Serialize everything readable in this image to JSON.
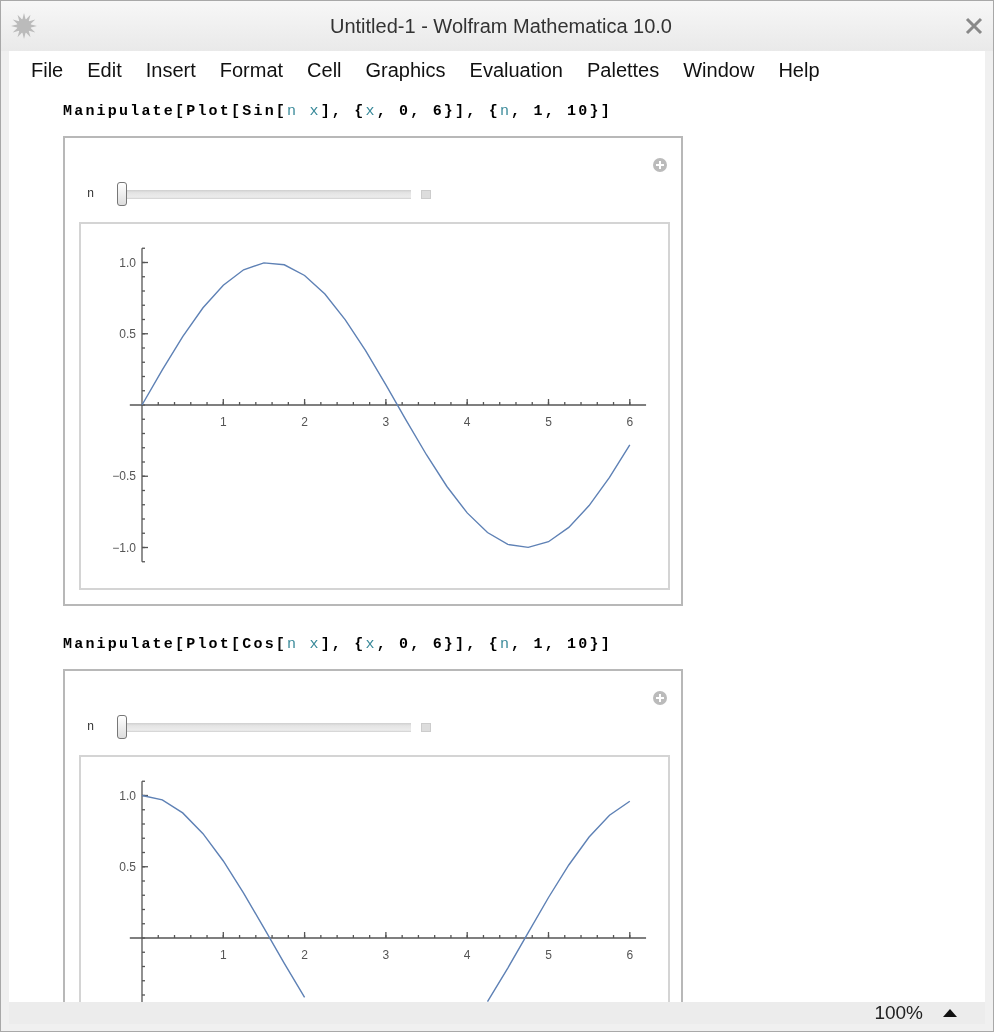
{
  "window": {
    "title": "Untitled-1 - Wolfram Mathematica 10.0"
  },
  "menu": [
    "File",
    "Edit",
    "Insert",
    "Format",
    "Cell",
    "Graphics",
    "Evaluation",
    "Palettes",
    "Window",
    "Help"
  ],
  "cells": [
    {
      "code": "**Manipulate[Plot[Sin[**n x**], {**x**, 0, 6}], {**n**, 1, 10}]**",
      "control": {
        "label": "n",
        "level": 0
      },
      "chart_data": {
        "type": "line",
        "x": [
          0,
          0.25,
          0.5,
          0.75,
          1,
          1.25,
          1.5,
          1.75,
          2,
          2.25,
          2.5,
          2.75,
          3,
          3.25,
          3.5,
          3.75,
          4,
          4.25,
          4.5,
          4.75,
          5,
          5.25,
          5.5,
          5.75,
          6
        ],
        "series": [
          {
            "color": "#5e81b5",
            "values": [
              0,
              0.247,
              0.479,
              0.682,
              0.841,
              0.949,
              0.997,
              0.984,
              0.909,
              0.778,
              0.598,
              0.382,
              0.141,
              -0.108,
              -0.351,
              -0.572,
              -0.757,
              -0.895,
              -0.978,
              -0.999,
              -0.959,
              -0.859,
              -0.706,
              -0.508,
              -0.279
            ]
          }
        ],
        "xlim": [
          -0.15,
          6.2
        ],
        "ylim": [
          -1.1,
          1.1
        ],
        "xticks": [
          1,
          2,
          3,
          4,
          5,
          6
        ],
        "yticks": [
          {
            "value": 1,
            "label": "1.0"
          },
          {
            "value": 0.5,
            "label": "0.5"
          },
          {
            "value": -0.5,
            "label": "−0.5"
          },
          {
            "value": -1,
            "label": "−1.0"
          }
        ]
      }
    },
    {
      "code": "**Manipulate[Plot[Cos[**n x**], {**x**, 0, 6}], {**n**, 1, 10}]**",
      "control": {
        "label": "n",
        "level": 0
      },
      "chart_data": {
        "type": "line",
        "x": [
          0,
          0.25,
          0.5,
          0.75,
          1,
          1.25,
          1.5,
          1.75,
          2,
          4.25,
          4.5,
          4.75,
          5,
          5.25,
          5.5,
          5.75,
          6
        ],
        "series": [
          {
            "color": "#5e81b5",
            "values": [
              1,
              0.969,
              0.878,
              0.732,
              0.54,
              0.315,
              0.071,
              -0.178,
              -0.416,
              -0.446,
              -0.211,
              0.038,
              0.284,
              0.512,
              0.709,
              0.861,
              0.96
            ]
          }
        ],
        "xlim": [
          -0.15,
          6.2
        ],
        "ylim": [
          -1.1,
          1.1
        ],
        "xticks": [
          1,
          2,
          3,
          4,
          5,
          6
        ],
        "yticks": [
          {
            "value": 1,
            "label": "1.0"
          },
          {
            "value": 0.5,
            "label": "0.5"
          }
        ]
      }
    }
  ],
  "status_bar": {
    "zoom": "100%"
  }
}
